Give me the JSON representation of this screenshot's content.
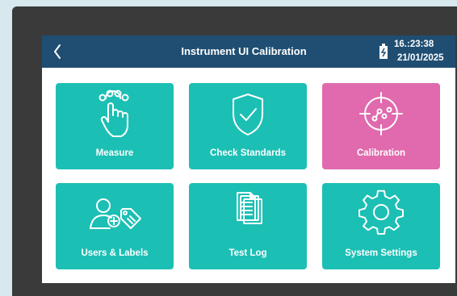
{
  "header": {
    "title": "Instrument UI Calibration",
    "time": "16.:23:38",
    "date": "21/01/2025",
    "back_icon": "chevron-left-icon",
    "battery_icon": "battery-icon",
    "color": "#1f4e72"
  },
  "tiles": [
    {
      "label": "Measure",
      "icon": "touch-gesture-icon",
      "color": "#1cbfb4"
    },
    {
      "label": "Check Standards",
      "icon": "shield-check-icon",
      "color": "#1cbfb4"
    },
    {
      "label": "Calibration",
      "icon": "crosshair-target-icon",
      "color": "#e06aad",
      "selected": true
    },
    {
      "label": "Users & Labels",
      "icon": "user-add-tag-icon",
      "color": "#1cbfb4"
    },
    {
      "label": "Test Log",
      "icon": "documents-icon",
      "color": "#1cbfb4"
    },
    {
      "label": "System Settings",
      "icon": "gear-icon",
      "color": "#1cbfb4"
    }
  ]
}
